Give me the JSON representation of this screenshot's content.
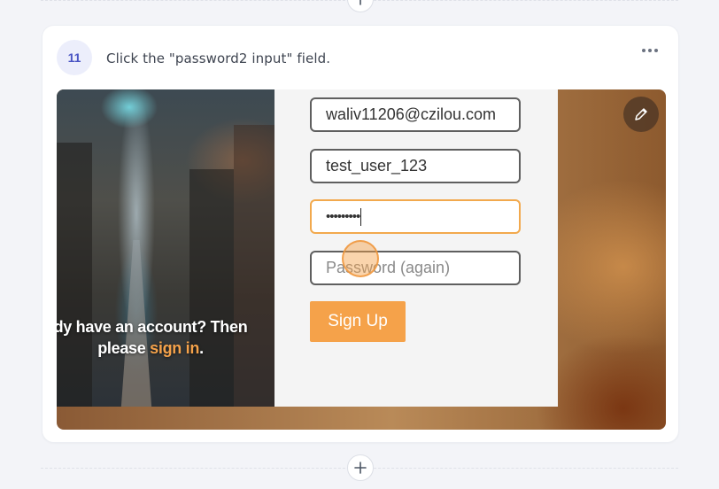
{
  "step": {
    "number": "11",
    "instruction": "Click the \"password2 input\" field."
  },
  "screenshot": {
    "form": {
      "email_value": "waliv11206@czilou.com",
      "username_value": "test_user_123",
      "password_value": "•••••••••",
      "password2_placeholder": "Password (again)",
      "signup_label": "Sign Up"
    },
    "account_prompt": {
      "line1": "dy have an account? Then",
      "line2_prefix": "please ",
      "link_text": "sign in",
      "line2_suffix": "."
    }
  },
  "icons": {
    "add_step": "plus-icon",
    "more": "more-horizontal-icon",
    "edit": "pencil-icon"
  },
  "colors": {
    "accent": "#f5a24a",
    "badge_text": "#4a55c4",
    "badge_bg": "#eceefb",
    "focused_border": "#f2a94d"
  }
}
